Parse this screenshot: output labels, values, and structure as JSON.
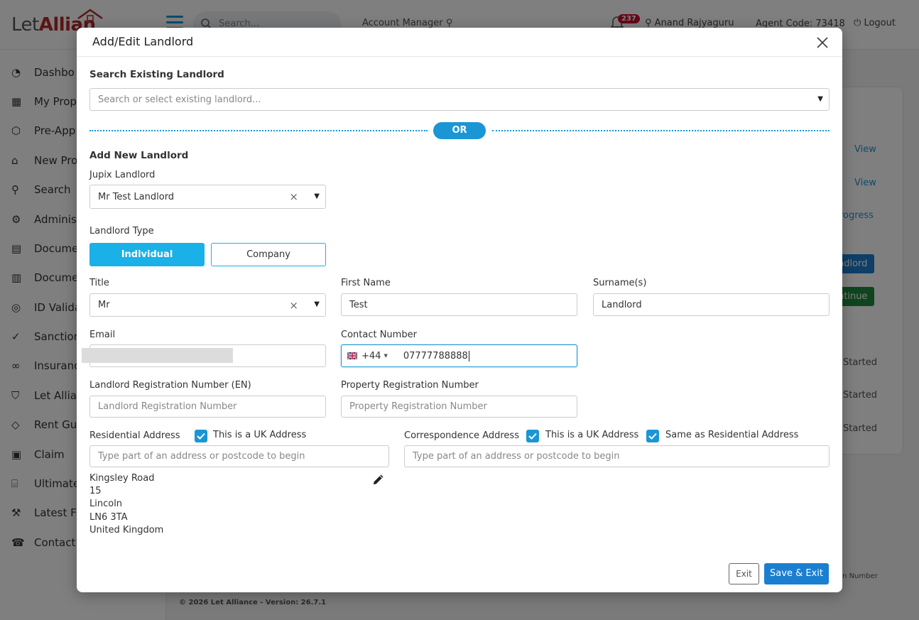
{
  "background": {
    "logo_let": "Let",
    "logo_alliance": "Allian",
    "search_placeholder": "Search...",
    "account_manager": "Account Manager",
    "notification_count": "237",
    "user_name": "Anand Rajyaguru",
    "agent_code": "Agent Code: 73418",
    "logout": "Logout",
    "sidebar": [
      {
        "label": "Dashbo",
        "icon": "dashboard-icon"
      },
      {
        "label": "My Prope",
        "icon": "building-icon"
      },
      {
        "label": "Pre-App",
        "icon": "box-icon"
      },
      {
        "label": "New Prop",
        "icon": "home-icon"
      },
      {
        "label": "Search",
        "icon": "search-icon"
      },
      {
        "label": "Adminis",
        "icon": "gear-icon"
      },
      {
        "label": "Docume",
        "icon": "document-icon"
      },
      {
        "label": "Docume",
        "icon": "document-signed-icon"
      },
      {
        "label": "ID Valida",
        "icon": "check-circle-icon"
      },
      {
        "label": "Sanction",
        "icon": "checkmark-icon"
      },
      {
        "label": "Insuranc",
        "icon": "link-icon"
      },
      {
        "label": "Let Allian",
        "icon": "shield-icon"
      },
      {
        "label": "Rent Gua",
        "icon": "shield-outline-icon"
      },
      {
        "label": "Claim",
        "icon": "clipboard-icon"
      },
      {
        "label": "Ultimate",
        "icon": "bank-icon"
      },
      {
        "label": "Latest Fe",
        "icon": "wrench-icon"
      },
      {
        "label": "Contact",
        "icon": "phone-icon"
      }
    ],
    "view_1": "View",
    "view_2": "View",
    "in_progress": "rogress",
    "landlord_btn": "ndlord",
    "continue_btn": "ntinue",
    "started_1": "Started",
    "started_2": "Started",
    "started_3": "Started",
    "footer": "© 2026 Let Alliance - Version: 26.7.1",
    "footer_right": "on Number"
  },
  "modal": {
    "title": "Add/Edit Landlord",
    "search_existing_label": "Search Existing Landlord",
    "search_existing_placeholder": "Search or select existing landlord...",
    "or_label": "OR",
    "add_new_label": "Add New Landlord",
    "jupix_label": "Jupix Landlord",
    "jupix_value": "Mr Test Landlord",
    "landlord_type_label": "Landlord Type",
    "type_individual": "Individual",
    "type_company": "Company",
    "title_label": "Title",
    "title_value": "Mr",
    "first_name_label": "First Name",
    "first_name_value": "Test",
    "surname_label": "Surname(s)",
    "surname_value": "Landlord",
    "email_label": "Email",
    "contact_label": "Contact Number",
    "dial_code": "+44",
    "contact_value": "07777788888",
    "landlord_reg_label": "Landlord Registration Number (EN)",
    "landlord_reg_placeholder": "Landlord Registration Number",
    "property_reg_label": "Property Registration Number",
    "property_reg_placeholder": "Property Registration Number",
    "residential_label": "Residential Address",
    "residential_uk_label": "This is a UK Address",
    "residential_placeholder": "Type part of an address or postcode to begin",
    "correspondence_label": "Correspondence Address",
    "correspondence_uk_label": "This is a UK Address",
    "same_as_label": "Same as Residential Address",
    "correspondence_placeholder": "Type part of an address or postcode to begin",
    "address_lines": [
      "Kingsley Road",
      "15",
      "Lincoln",
      "LN6 3TA",
      "United Kingdom"
    ],
    "exit_label": "Exit",
    "save_label": "Save & Exit"
  },
  "colors": {
    "accent": "#1a96d4",
    "individual_active": "#1ab0e8",
    "save_button": "#1a7fd0",
    "brand_red": "#b22b2b"
  }
}
